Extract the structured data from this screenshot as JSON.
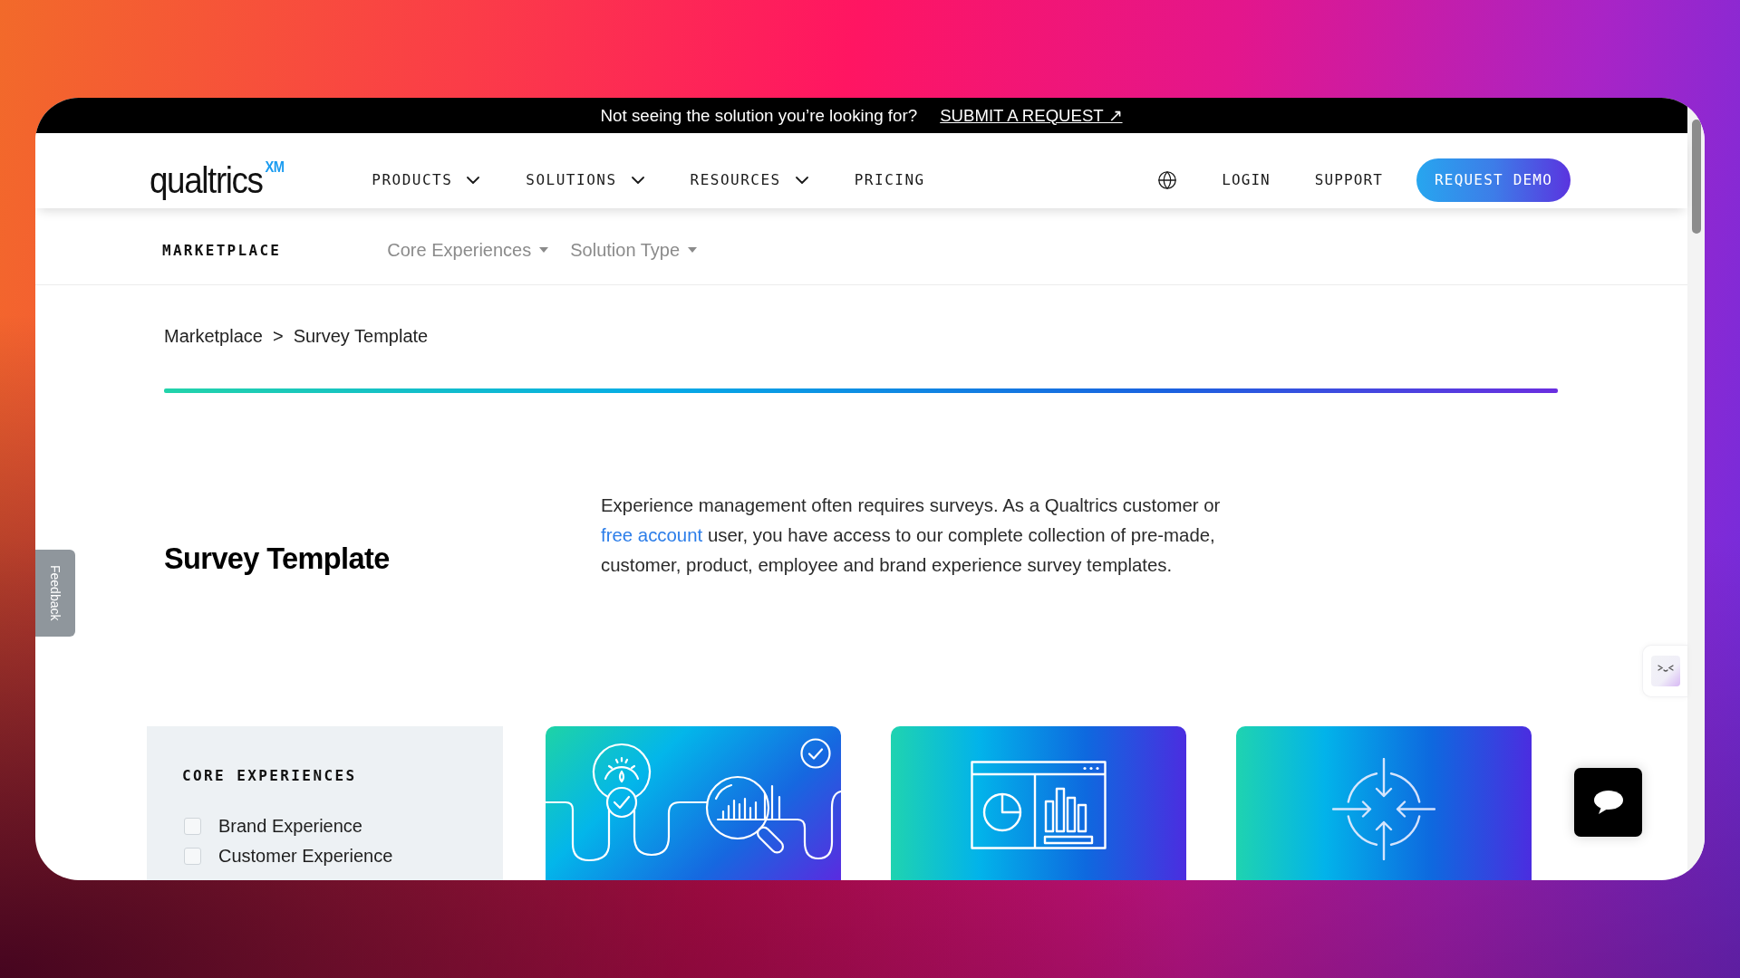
{
  "announcement": {
    "text": "Not seeing the solution you’re looking for?",
    "link": "SUBMIT A REQUEST ↗"
  },
  "header": {
    "logo": {
      "wordmark": "qualtrics",
      "mark": "XM"
    },
    "nav": [
      {
        "label": "PRODUCTS",
        "dropdown": true
      },
      {
        "label": "SOLUTIONS",
        "dropdown": true
      },
      {
        "label": "RESOURCES",
        "dropdown": true
      },
      {
        "label": "PRICING",
        "dropdown": false
      }
    ],
    "links": [
      "LOGIN",
      "SUPPORT"
    ],
    "cta": "REQUEST DEMO"
  },
  "subnav": {
    "title": "MARKETPLACE",
    "filters": [
      "Core Experiences",
      "Solution Type"
    ]
  },
  "breadcrumb": {
    "items": [
      "Marketplace",
      "Survey Template"
    ],
    "separator": ">"
  },
  "hero": {
    "title": "Survey Template",
    "description": {
      "before": "Experience management often requires surveys. As a Qualtrics customer or ",
      "link": "free account",
      "after": " user, you have access to our complete collection of pre-made, customer, product, employee and brand experience survey templates."
    }
  },
  "filter_panel": {
    "heading": "CORE EXPERIENCES",
    "options": [
      {
        "label": "Brand Experience",
        "checked": false
      },
      {
        "label": "Customer Experience",
        "checked": false
      }
    ]
  },
  "cards": [
    {
      "kind": "gauge-search",
      "verified": true
    },
    {
      "kind": "dashboard",
      "verified": false
    },
    {
      "kind": "target",
      "verified": false
    }
  ],
  "feedback_tab": {
    "label": "Feedback"
  }
}
